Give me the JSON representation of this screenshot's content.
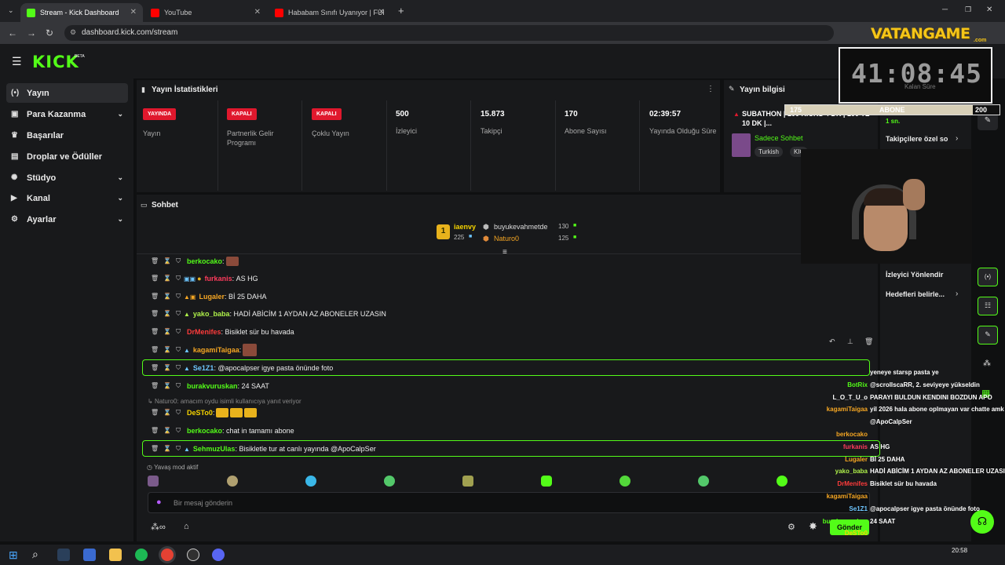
{
  "browser": {
    "tabs": [
      {
        "title": "Stream - Kick Dashboard",
        "active": true
      },
      {
        "title": "YouTube",
        "active": false
      },
      {
        "title": "Hababam Sınıfı Uyanıyor | FULL",
        "active": false
      }
    ],
    "url": "dashboard.kick.com/stream"
  },
  "brand": {
    "logo": "KICK",
    "beta": "BETA"
  },
  "sidebar": {
    "items": [
      {
        "label": "Yayın",
        "icon": "broadcast-icon"
      },
      {
        "label": "Para Kazanma",
        "icon": "money-icon"
      },
      {
        "label": "Başarılar",
        "icon": "trophy-icon"
      },
      {
        "label": "Droplar ve Ödüller",
        "icon": "gift-icon"
      },
      {
        "label": "Stüdyo",
        "icon": "studio-icon"
      },
      {
        "label": "Kanal",
        "icon": "channel-icon"
      },
      {
        "label": "Ayarlar",
        "icon": "gear-icon"
      }
    ]
  },
  "stats": {
    "title": "Yayın İstatistikleri",
    "items": [
      {
        "badge": "YAYINDA",
        "label": "Yayın"
      },
      {
        "badge": "KAPALI",
        "label": "Partnerlik Gelir Programı"
      },
      {
        "badge": "KAPALI",
        "label": "Çoklu Yayın"
      },
      {
        "value": "500",
        "label": "İzleyici"
      },
      {
        "value": "15.873",
        "label": "Takipçi"
      },
      {
        "value": "170",
        "label": "Abone Sayısı"
      },
      {
        "value": "02:39:57",
        "label": "Yayında Olduğu Süre"
      }
    ]
  },
  "info": {
    "title": "Yayın bilgisi",
    "stream_title": "SUBATHON | 100 KİCKS 4 DK | 100 TL 10 DK |...",
    "category": "Sadece Sohbet",
    "tags": [
      "Turkish",
      "KIC"
    ]
  },
  "chat": {
    "title": "Sohbet",
    "leaders": {
      "first": {
        "name": "iaenvy",
        "count": "225",
        "rank": "1"
      },
      "second": {
        "name": "buyukevahmetde",
        "count": "130"
      },
      "third": {
        "name": "Naturo0",
        "count": "125"
      }
    },
    "messages": [
      {
        "user": "berkocako",
        "color": "#53fc18",
        "text": ""
      },
      {
        "user": "furkanis",
        "color": "#ff3b5c",
        "text": "AS HG"
      },
      {
        "user": "Lugaler",
        "color": "#f5a623",
        "text": "Bİ 25 DAHA"
      },
      {
        "user": "yako_baba",
        "color": "#aef04a",
        "text": "HADİ ABİCİM 1 AYDAN AZ ABONELER UZASIN"
      },
      {
        "user": "DrMenifes",
        "color": "#ff3b3b",
        "text": "Bisiklet sür bu havada"
      },
      {
        "user": "kagamiTaigaa",
        "color": "#f5a623",
        "text": ""
      },
      {
        "user": "Se1Z1",
        "color": "#6ec6ff",
        "text": "@apocalpser igye pasta önünde foto"
      },
      {
        "user": "burakvuruskan",
        "color": "#53fc18",
        "text": "24 SAAT"
      },
      {
        "user": "DeSTo0",
        "color": "#f5d300",
        "text": ""
      },
      {
        "user": "berkocako",
        "color": "#53fc18",
        "text": "chat in tamamı abone"
      },
      {
        "user": "SehmuzUlas",
        "color": "#53fc18",
        "text": "Bisikletle tur at canlı yayında @ApoCalpSer"
      }
    ],
    "reply_note": "Naturo0: amacım oydu isimli kullanıcıya yanıt veriyor",
    "slow_mode": "Yavaş mod aktif",
    "input_placeholder": "Bir mesaj gönderin",
    "send_label": "Gönder"
  },
  "right_panel": {
    "items": [
      "1 sn.",
      "Takipçilere özel so",
      "İzleyici Yönlendir",
      "Hedefleri belirle..."
    ]
  },
  "overlay": {
    "brand": "VATANGAME",
    "brand_sub": ".com",
    "timer": "41:08:45",
    "timer_sub": "Kalan Süre",
    "goal_left": "175",
    "goal_label": "ABONE",
    "goal_right": "200",
    "goal_progress": 0.875,
    "chat": [
      {
        "name": "",
        "msg": "yeneye starsp pasta ye"
      },
      {
        "name": "BotRix",
        "msg": "@scrollscaRR, 2. seviyeye yükseldin"
      },
      {
        "name": "L_O_T_U_o",
        "msg": "PARAYI BULDUN KENDINI BOZDUN APO"
      },
      {
        "name": "kagamiTaigaa",
        "msg": "yil 2026 hala abone oplmayan var chatte amk"
      },
      {
        "name": "",
        "msg": "@ApoCalpSer"
      },
      {
        "name": "berkocako",
        "msg": ""
      },
      {
        "name": "furkanis",
        "msg": "AS HG"
      },
      {
        "name": "Lugaler",
        "msg": "Bİ 25 DAHA"
      },
      {
        "name": "yako_baba",
        "msg": "HADİ ABİCİM 1 AYDAN AZ ABONELER UZASIN"
      },
      {
        "name": "DrMenifes",
        "msg": "Bisiklet sür bu havada"
      },
      {
        "name": "kagamiTaigaa",
        "msg": ""
      },
      {
        "name": "Se1Z1",
        "msg": "@apocalpser igye pasta önünde foto"
      },
      {
        "name": "burakvuruskan",
        "msg": "24 SAAT"
      },
      {
        "name": "DeSTo0",
        "msg": ""
      },
      {
        "name": "berkocako",
        "msg": "chat in tamamı abone"
      },
      {
        "name": "SehmuzUlas",
        "msg": "Bisikletle tur at canlı yayında @ApoCalpSer"
      }
    ]
  },
  "taskbar": {
    "time": "20:58"
  },
  "colors": {
    "accent": "#53fc18",
    "bg": "#0f1011",
    "panel": "#18191b",
    "live": "#e0182d"
  }
}
